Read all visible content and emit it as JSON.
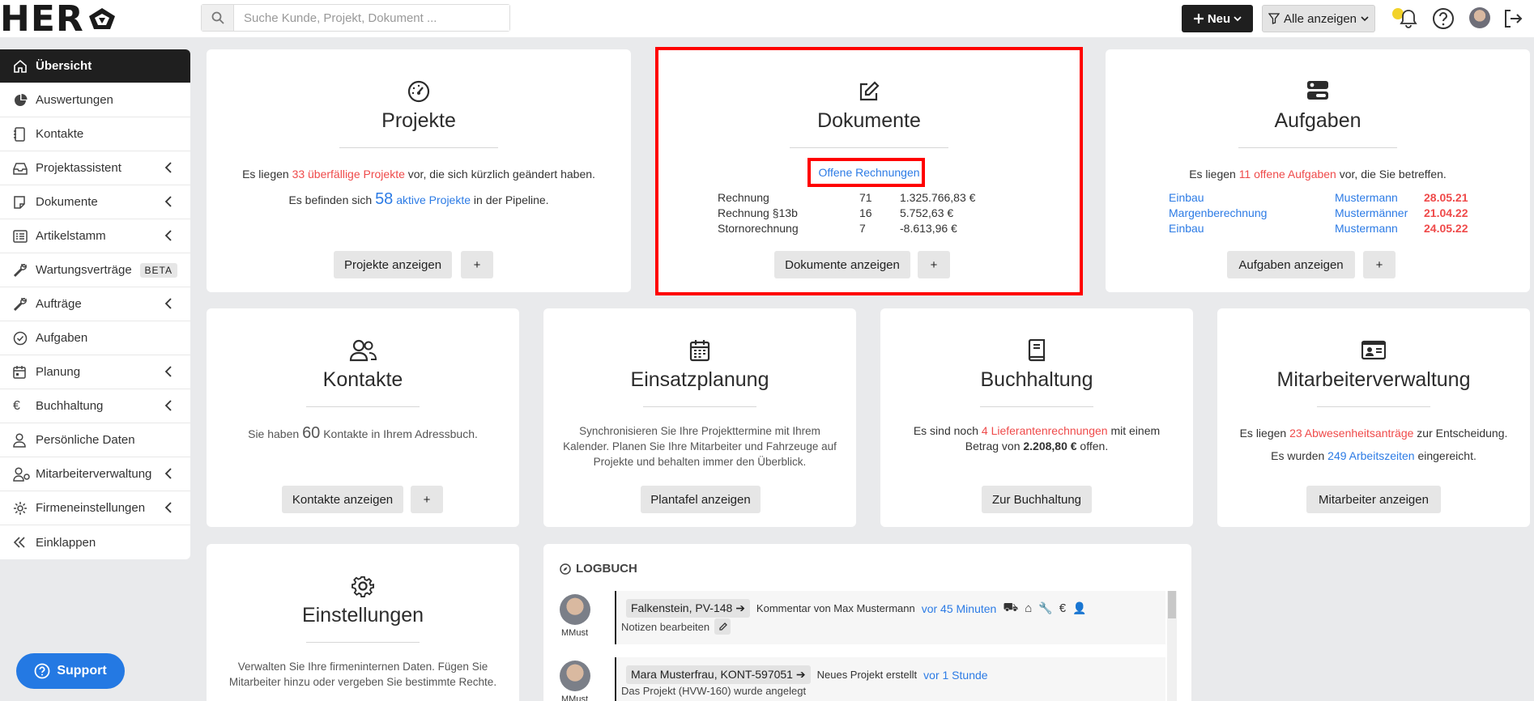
{
  "header": {
    "logo_text": "HER",
    "search_placeholder": "Suche Kunde, Projekt, Dokument ...",
    "new_label": "Neu",
    "filter_label": "Alle anzeigen"
  },
  "sidebar": {
    "items": [
      {
        "label": "Übersicht"
      },
      {
        "label": "Auswertungen"
      },
      {
        "label": "Kontakte"
      },
      {
        "label": "Projektassistent"
      },
      {
        "label": "Dokumente"
      },
      {
        "label": "Artikelstamm"
      },
      {
        "label": "Wartungsverträge",
        "badge": "BETA"
      },
      {
        "label": "Aufträge"
      },
      {
        "label": "Aufgaben"
      },
      {
        "label": "Planung"
      },
      {
        "label": "Buchhaltung"
      },
      {
        "label": "Persönliche Daten"
      },
      {
        "label": "Mitarbeiterverwaltung"
      },
      {
        "label": "Firmeneinstellungen"
      },
      {
        "label": "Einklappen"
      }
    ]
  },
  "projekte": {
    "title": "Projekte",
    "line1_pre": "Es liegen ",
    "line1_highlight": "33 überfällige Projekte",
    "line1_post": " vor, die sich kürzlich geändert haben.",
    "line2_pre": "Es befinden sich ",
    "line2_count": "58",
    "line2_link": " aktive Projekte",
    "line2_post": " in der Pipeline.",
    "button": "Projekte anzeigen",
    "add": "+"
  },
  "dokumente": {
    "title": "Dokumente",
    "link": "Offene Rechnungen",
    "rows": [
      {
        "type": "Rechnung",
        "count": "71",
        "amount": "1.325.766,83 €"
      },
      {
        "type": "Rechnung §13b",
        "count": "16",
        "amount": "5.752,63 €"
      },
      {
        "type": "Stornorechnung",
        "count": "7",
        "amount": "-8.613,96 €"
      }
    ],
    "button": "Dokumente anzeigen",
    "add": "+"
  },
  "aufgaben": {
    "title": "Aufgaben",
    "line_pre": "Es liegen ",
    "line_highlight": "11 offene Aufgaben",
    "line_post": " vor, die Sie betreffen.",
    "rows": [
      {
        "task": "Einbau",
        "person": "Mustermann",
        "date": "28.05.21"
      },
      {
        "task": "Margenberechnung",
        "person": "Mustermänner",
        "date": "21.04.22"
      },
      {
        "task": "Einbau",
        "person": "Mustermann",
        "date": "24.05.22"
      }
    ],
    "button": "Aufgaben anzeigen",
    "add": "+"
  },
  "kontakte": {
    "title": "Kontakte",
    "line_pre": "Sie haben ",
    "line_count": "60",
    "line_post": " Kontakte in Ihrem Adressbuch.",
    "button": "Kontakte anzeigen",
    "add": "+"
  },
  "einsatzplanung": {
    "title": "Einsatzplanung",
    "text": "Synchronisieren Sie Ihre Projekttermine mit Ihrem Kalender. Planen Sie Ihre Mitarbeiter und Fahrzeuge auf Projekte und behalten immer den Überblick.",
    "button": "Plantafel anzeigen"
  },
  "buchhaltung": {
    "title": "Buchhaltung",
    "line_pre": "Es sind noch ",
    "line_highlight": "4 Lieferantenrechnungen",
    "line_mid": " mit einem Betrag von ",
    "line_amount": "2.208,80 €",
    "line_post": " offen.",
    "button": "Zur Buchhaltung"
  },
  "mitarbeiter": {
    "title": "Mitarbeiterverwaltung",
    "line1_pre": "Es liegen ",
    "line1_highlight": "23 Abwesenheitsanträge",
    "line1_post": " zur Entscheidung.",
    "line2_pre": "Es wurden ",
    "line2_link": "249 Arbeitszeiten",
    "line2_post": " eingereicht.",
    "button": "Mitarbeiter anzeigen"
  },
  "einstellungen": {
    "title": "Einstellungen",
    "text": "Verwalten Sie Ihre firmeninternen Daten. Fügen Sie Mitarbeiter hinzu oder vergeben Sie bestimmte Rechte."
  },
  "logbuch": {
    "title": "LOGBUCH",
    "entries": [
      {
        "user": "MMust",
        "chip": "Falkenstein, PV-148",
        "action": "Kommentar von Max Mustermann",
        "time": "vor 45 Minuten",
        "note": "Notizen bearbeiten"
      },
      {
        "user": "MMust",
        "chip": "Mara Musterfrau, KONT-597051",
        "action": "Neues Projekt erstellt",
        "time": "vor 1 Stunde",
        "note": "Das Projekt (HVW-160) wurde angelegt"
      }
    ]
  },
  "support": {
    "label": "Support"
  }
}
